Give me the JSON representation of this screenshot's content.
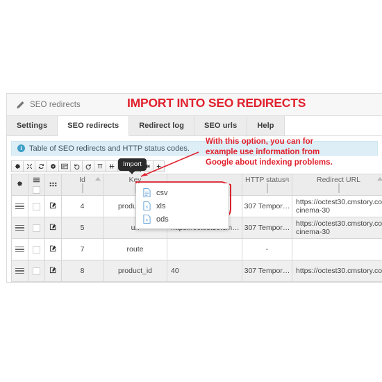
{
  "breadcrumb": {
    "label": "SEO redirects",
    "icon": "pencil-icon"
  },
  "annotations": {
    "title": "IMPORT INTO SEO REDIRECTS",
    "note_line1": "With this option, you can for",
    "note_line2": "example use information from",
    "note_line3": "Google about indexing problems.",
    "accent_color": "#e1222e"
  },
  "tabs": [
    {
      "label": "Settings",
      "active": false
    },
    {
      "label": "SEO redirects",
      "active": true
    },
    {
      "label": "Redirect log",
      "active": false
    },
    {
      "label": "SEO urls",
      "active": false
    },
    {
      "label": "Help",
      "active": false
    }
  ],
  "info_bar": {
    "icon": "info-circle-icon",
    "text": "Table of SEO redirects and HTTP status codes."
  },
  "tooltip": {
    "text": "Import"
  },
  "toolbar": {
    "buttons": [
      {
        "name": "settings-gear-button",
        "icon": "gear-icon"
      },
      {
        "name": "fullscreen-button",
        "icon": "expand-arrows-icon"
      },
      {
        "name": "refresh-button",
        "icon": "refresh-icon"
      },
      {
        "name": "record-button",
        "icon": "filled-circle-icon"
      },
      {
        "name": "card-view-button",
        "icon": "id-card-icon"
      },
      {
        "name": "undo-button",
        "icon": "undo-arrow-icon"
      },
      {
        "name": "redo-button",
        "icon": "redo-arrow-icon"
      },
      {
        "name": "align-top-button",
        "icon": "align-top-icon"
      },
      {
        "name": "align-middle-button",
        "icon": "align-middle-icon"
      },
      {
        "name": "align-bottom-button",
        "icon": "align-bottom-icon"
      },
      {
        "name": "import-button",
        "icon": "import-icon",
        "pressed": true
      },
      {
        "name": "export-button",
        "icon": "export-icon"
      },
      {
        "name": "add-row-button",
        "icon": "plus-icon"
      }
    ]
  },
  "import_menu": {
    "items": [
      {
        "label": "csv",
        "icon": "file-csv-icon"
      },
      {
        "label": "xls",
        "icon": "file-xls-icon"
      },
      {
        "label": "ods",
        "icon": "file-ods-icon"
      }
    ]
  },
  "table": {
    "headers": [
      {
        "label": "",
        "icon": "gear-icon"
      },
      {
        "label": "",
        "icon": "list-lines-icon"
      },
      {
        "label": "",
        "icon": "grid-dots-icon"
      },
      {
        "label": "Id",
        "sortable": true
      },
      {
        "label": "Key",
        "sortable": false
      },
      {
        "label": "",
        "sortable": false
      },
      {
        "label": "HTTP status cod",
        "sortable": true
      },
      {
        "label": "Redirect URL",
        "sortable": true
      },
      {
        "label": "",
        "sortable": true
      }
    ],
    "rows": [
      {
        "id": "4",
        "key": "product_id",
        "value": "",
        "status": "307 Tempor…",
        "url": "https://octest30.cmstory.co… cinema-30",
        "tail": ""
      },
      {
        "id": "5",
        "key": "url",
        "value": "https://octest30.cm…",
        "status": "307 Tempor…",
        "url": "https://octest30.cmstory.co… cinema-30",
        "tail": ""
      },
      {
        "id": "7",
        "key": "route",
        "value": "",
        "status": "-",
        "url": "",
        "tail": ""
      },
      {
        "id": "8",
        "key": "product_id",
        "value": "40",
        "status": "307 Tempor…",
        "url": "https://octest30.cmstory.co…",
        "tail": ""
      }
    ]
  }
}
